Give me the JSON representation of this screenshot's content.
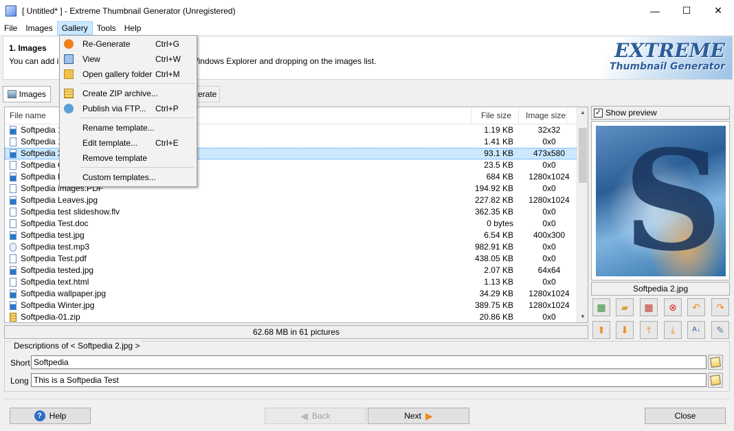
{
  "window": {
    "title": "[ Untitled* ] - Extreme Thumbnail Generator (Unregistered)",
    "minimize": "—",
    "maximize": "☐",
    "close": "✕"
  },
  "menu": {
    "file": "File",
    "images": "Images",
    "gallery": "Gallery",
    "tools": "Tools",
    "help": "Help"
  },
  "header": {
    "title": "1. Images",
    "desc_left": "You can add im",
    "desc_right": "Windows Explorer and dropping on the images list.",
    "logo_line1": "EXTREME",
    "logo_line2": "Thumbnail Generator"
  },
  "tabs": {
    "images": "Images",
    "generate": "erate"
  },
  "list": {
    "col_filename": "File name",
    "col_filesize": "File size",
    "col_imagesize": "Image size",
    "rows": [
      {
        "name": "Softpedia 1.",
        "size": "1.19 KB",
        "dim": "32x32",
        "icon": "image-file-icon"
      },
      {
        "name": "Softpedia 1.",
        "size": "1.41 KB",
        "dim": "0x0",
        "icon": "pdf-file-icon"
      },
      {
        "name": "Softpedia 2.",
        "size": "93.1 KB",
        "dim": "473x580",
        "icon": "image-file-icon"
      },
      {
        "name": "Softpedia Co",
        "size": "23.5 KB",
        "dim": "0x0",
        "icon": "blank-file-icon"
      },
      {
        "name": "Softpedia Fo",
        "size": "684 KB",
        "dim": "1280x1024",
        "icon": "image-file-icon"
      },
      {
        "name": "Softpedia images.PDF",
        "size": "194.92 KB",
        "dim": "0x0",
        "icon": "pdf-file-icon"
      },
      {
        "name": "Softpedia Leaves.jpg",
        "size": "227.82 KB",
        "dim": "1280x1024",
        "icon": "image-file-icon"
      },
      {
        "name": "Softpedia test slideshow.flv",
        "size": "362.35 KB",
        "dim": "0x0",
        "icon": "blank-file-icon"
      },
      {
        "name": "Softpedia Test.doc",
        "size": "0 bytes",
        "dim": "0x0",
        "icon": "blank-file-icon"
      },
      {
        "name": "Softpedia test.jpg",
        "size": "6.54 KB",
        "dim": "400x300",
        "icon": "image-file-icon"
      },
      {
        "name": "Softpedia test.mp3",
        "size": "982.91 KB",
        "dim": "0x0",
        "icon": "audio-file-icon"
      },
      {
        "name": "Softpedia Test.pdf",
        "size": "438.05 KB",
        "dim": "0x0",
        "icon": "pdf-file-icon"
      },
      {
        "name": "Softpedia tested.jpg",
        "size": "2.07 KB",
        "dim": "64x64",
        "icon": "image-file-icon"
      },
      {
        "name": "Softpedia text.html",
        "size": "1.13 KB",
        "dim": "0x0",
        "icon": "html-file-icon"
      },
      {
        "name": "Softpedia wallpaper.jpg",
        "size": "34.29 KB",
        "dim": "1280x1024",
        "icon": "image-file-icon"
      },
      {
        "name": "Softpedia Winter.jpg",
        "size": "389.75 KB",
        "dim": "1280x1024",
        "icon": "image-file-icon"
      },
      {
        "name": "Softpedia-01.zip",
        "size": "20.86 KB",
        "dim": "0x0",
        "icon": "zip-file-icon"
      }
    ],
    "selected_index": 2,
    "status": "62.68 MB in 61 pictures"
  },
  "preview": {
    "show_preview": "Show preview",
    "checked": true,
    "caption": "Softpedia 2.jpg",
    "image_letter": "S"
  },
  "toolbar_icons": [
    "add-images-icon",
    "add-folder-icon",
    "remove-images-icon",
    "clear-list-icon",
    "undo-icon",
    "redo-icon",
    "move-top-icon",
    "move-down-icon",
    "move-up-icon",
    "move-bottom-icon",
    "sort-az-icon",
    "edit-description-icon"
  ],
  "descriptions": {
    "legend": "Descriptions of < Softpedia 2.jpg >",
    "short_label": "Short",
    "short_value": "Softpedia",
    "long_label": "Long",
    "long_value": "This is a Softpedia Test"
  },
  "buttons": {
    "help": "Help",
    "back": "Back",
    "next": "Next",
    "close": "Close"
  },
  "gallery_menu": {
    "regenerate": "Re-Generate",
    "regenerate_sc": "Ctrl+G",
    "view": "View",
    "view_sc": "Ctrl+W",
    "open_folder": "Open gallery folder",
    "open_folder_sc": "Ctrl+M",
    "zip": "Create ZIP archive...",
    "ftp": "Publish via FTP...",
    "ftp_sc": "Ctrl+P",
    "rename": "Rename template...",
    "edit": "Edit template...",
    "edit_sc": "Ctrl+E",
    "remove": "Remove template",
    "custom": "Custom templates..."
  },
  "colors": {
    "selection": "#cce8ff",
    "accent": "#2d5d9a",
    "arrow": "#f08a1a"
  }
}
